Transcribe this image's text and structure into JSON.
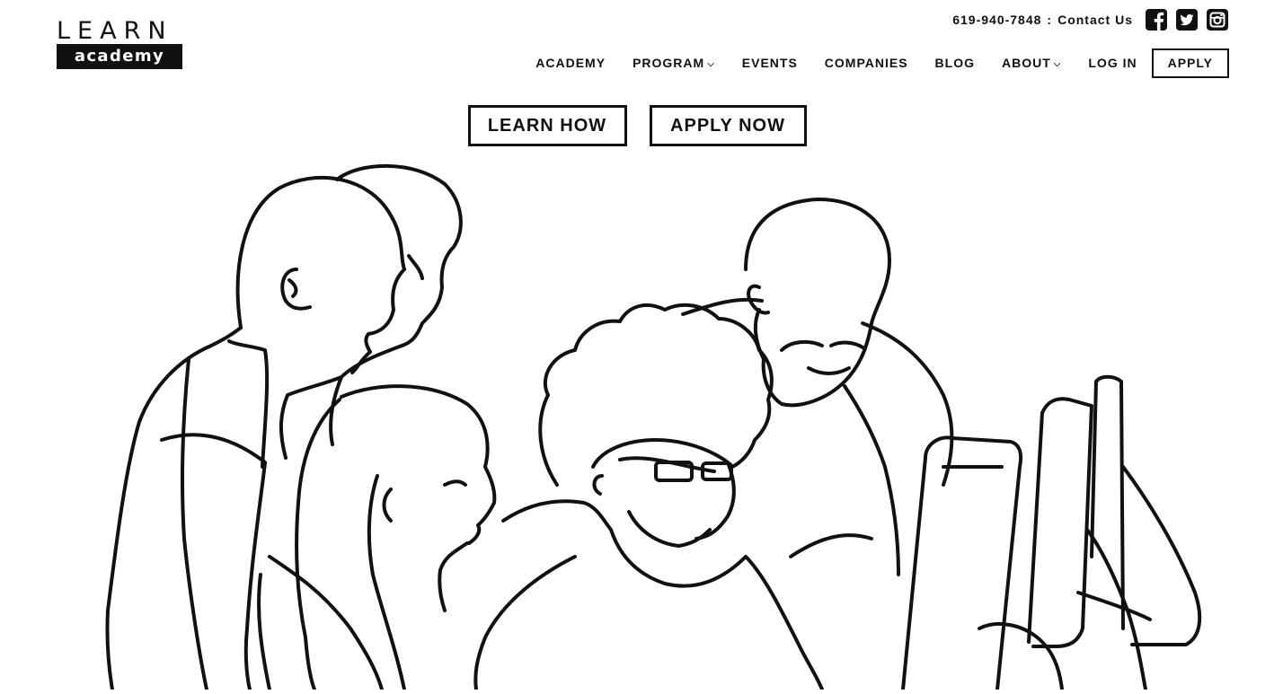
{
  "logo": {
    "top": "LEARN",
    "bottom": "academy"
  },
  "topbar": {
    "phone": "619-940-7848",
    "separator": ":",
    "contact": "Contact Us",
    "social": [
      {
        "icon": "facebook-icon"
      },
      {
        "icon": "twitter-icon"
      },
      {
        "icon": "instagram-icon"
      }
    ]
  },
  "nav": {
    "items": [
      {
        "label": "ACADEMY",
        "dropdown": false
      },
      {
        "label": "PROGRAM",
        "dropdown": true
      },
      {
        "label": "EVENTS",
        "dropdown": false
      },
      {
        "label": "COMPANIES",
        "dropdown": false
      },
      {
        "label": "BLOG",
        "dropdown": false
      },
      {
        "label": "ABOUT",
        "dropdown": true
      },
      {
        "label": "LOG IN",
        "dropdown": false
      }
    ],
    "apply": "APPLY"
  },
  "hero": {
    "learn_how": "LEARN HOW",
    "apply_now": "APPLY NOW"
  },
  "colors": {
    "ink": "#111111",
    "background": "#ffffff"
  }
}
